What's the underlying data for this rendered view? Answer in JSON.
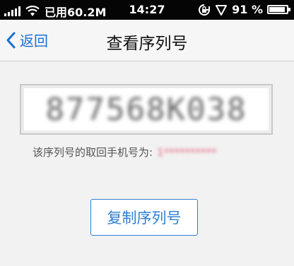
{
  "status_bar": {
    "carrier": "已用60.2M",
    "time": "14:27",
    "battery_text": "91 %",
    "battery_level": 0.91
  },
  "nav": {
    "back_label": "返回",
    "title": "查看序列号"
  },
  "serial": {
    "value": "877568K038"
  },
  "retrieve_label": "该序列号的取回手机号为:",
  "masked_phone": "1**********",
  "copy_button_label": "复制序列号",
  "colors": {
    "accent": "#2f7fd2",
    "statusbar_bg": "#050505",
    "page_bg": "#f2f2f2"
  },
  "icons": [
    "signal-icon",
    "wifi-icon",
    "rotation-lock-icon",
    "location-icon",
    "battery-icon",
    "chevron-left-icon"
  ]
}
